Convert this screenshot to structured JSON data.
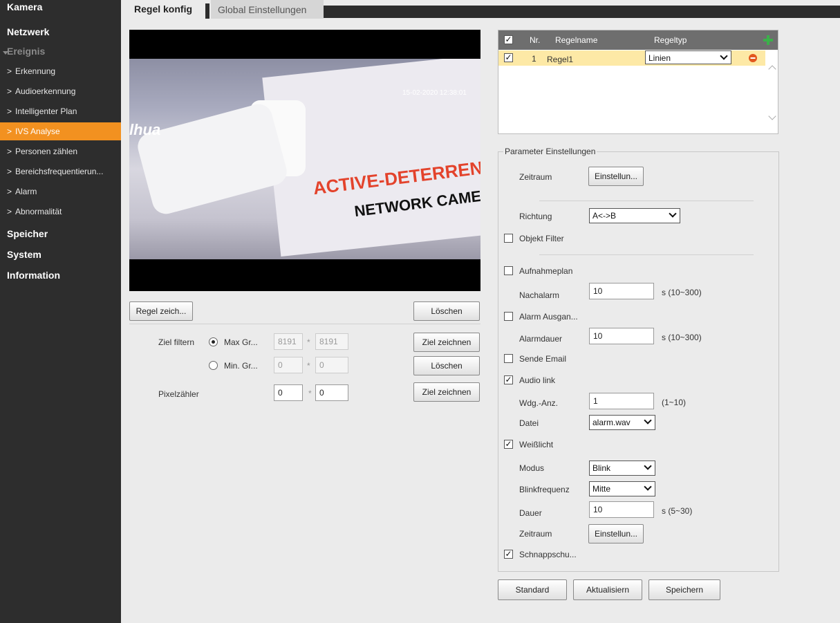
{
  "sidebar": {
    "kamera": "Kamera",
    "netzwerk": "Netzwerk",
    "ereignis": "Ereignis",
    "items": [
      "Erkennung",
      "Audioerkennung",
      "Intelligenter Plan",
      "IVS Analyse",
      "Personen zählen",
      "Bereichsfrequentierun...",
      "Alarm",
      "Abnormalität"
    ],
    "active_index": 3,
    "speicher": "Speicher",
    "system": "System",
    "information": "Information",
    "chevron": ">"
  },
  "tabs": {
    "active": "Regel konfig",
    "inactive": "Global Einstellungen"
  },
  "video": {
    "timestamp": "15-02-2020 12:38:01",
    "brand": "lhua",
    "sign_line1": "ACTIVE-DETERRENCE",
    "sign_line2": "NETWORK CAMERA"
  },
  "left_panel": {
    "draw_rule_button": "Regel zeich...",
    "clear_button": "Löschen",
    "ziel_filtern_label": "Ziel filtern",
    "max_label": "Max Gr...",
    "max_w": "8191",
    "max_h": "8191",
    "min_label": "Min. Gr...",
    "min_w": "0",
    "min_h": "0",
    "times": "*",
    "draw_target_button": "Ziel zeichnen",
    "clear_target_button": "Löschen",
    "pixel_label": "Pixelzähler",
    "pixel_w": "0",
    "pixel_h": "0",
    "draw_target_button2": "Ziel zeichnen"
  },
  "rules_table": {
    "col_nr": "Nr.",
    "col_name": "Regelname",
    "col_type": "Regeltyp",
    "row": {
      "nr": "1",
      "name": "Regel1",
      "type": "Linien",
      "checked": true
    }
  },
  "params": {
    "legend": "Parameter Einstellungen",
    "zeitraum_label": "Zeitraum",
    "einstellung_button": "Einstellun...",
    "richtung_label": "Richtung",
    "richtung_value": "A<->B",
    "objekt_filter": "Objekt Filter",
    "aufnahmeplan": "Aufnahmeplan",
    "nachalarm_label": "Nachalarm",
    "nachalarm_value": "10",
    "nachalarm_range": "s (10~300)",
    "alarm_ausgang": "Alarm Ausgan...",
    "alarmdauer_label": "Alarmdauer",
    "alarmdauer_value": "10",
    "alarmdauer_range": "s (10~300)",
    "sende_email": "Sende Email",
    "audio_link": "Audio link",
    "wdg_label": "Wdg.-Anz.",
    "wdg_value": "1",
    "wdg_range": "(1~10)",
    "datei_label": "Datei",
    "datei_value": "alarm.wav",
    "weisslicht": "Weißlicht",
    "modus_label": "Modus",
    "modus_value": "Blink",
    "blinkfreq_label": "Blinkfrequenz",
    "blinkfreq_value": "Mitte",
    "dauer_label": "Dauer",
    "dauer_value": "10",
    "dauer_range": "s (5~30)",
    "zeitraum2_label": "Zeitraum",
    "einstellung2_button": "Einstellun...",
    "schnappschuss": "Schnappschu...",
    "check_mark": "✓"
  },
  "footer": {
    "standard": "Standard",
    "aktualisieren": "Aktualisiern",
    "speichern": "Speichern"
  },
  "colors": {
    "sidebar_bg": "#2d2d2d",
    "active_item": "#f29120",
    "selected_row": "#fde9a6",
    "table_header": "#6e6e6e"
  }
}
